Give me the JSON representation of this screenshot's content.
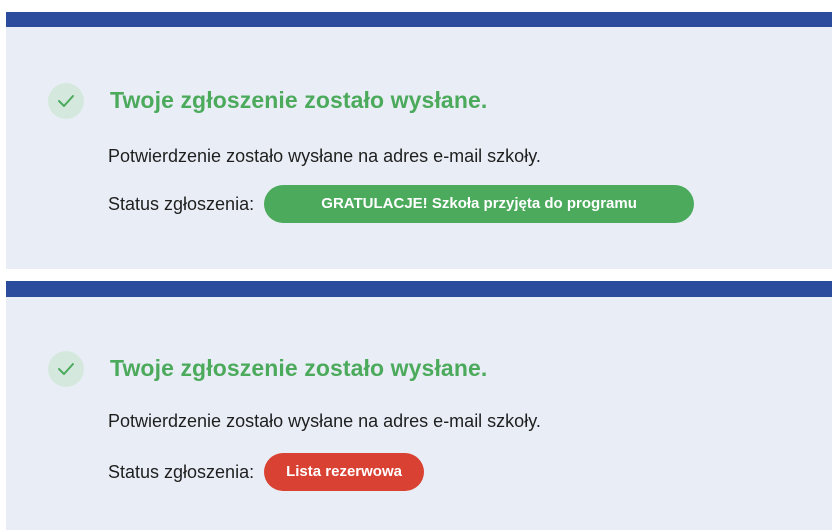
{
  "colors": {
    "topbar": "#2b4c9c",
    "panel_bg": "#e9eef6",
    "success_green": "#4caa5c",
    "check_bg": "#d5e8de",
    "reserve_red": "#d94133"
  },
  "panels": [
    {
      "icon": "check-icon",
      "title": "Twoje zgłoszenie zostało wysłane.",
      "message": "Potwierdzenie zostało wysłane na adres e-mail szkoły.",
      "status_label": "Status zgłoszenia:",
      "status_badge": "GRATULACJE! Szkoła przyjęta do programu",
      "status_color": "green"
    },
    {
      "icon": "check-icon",
      "title": "Twoje zgłoszenie zostało wysłane.",
      "message": "Potwierdzenie zostało wysłane na adres e-mail szkoły.",
      "status_label": "Status zgłoszenia:",
      "status_badge": "Lista rezerwowa",
      "status_color": "red"
    }
  ]
}
